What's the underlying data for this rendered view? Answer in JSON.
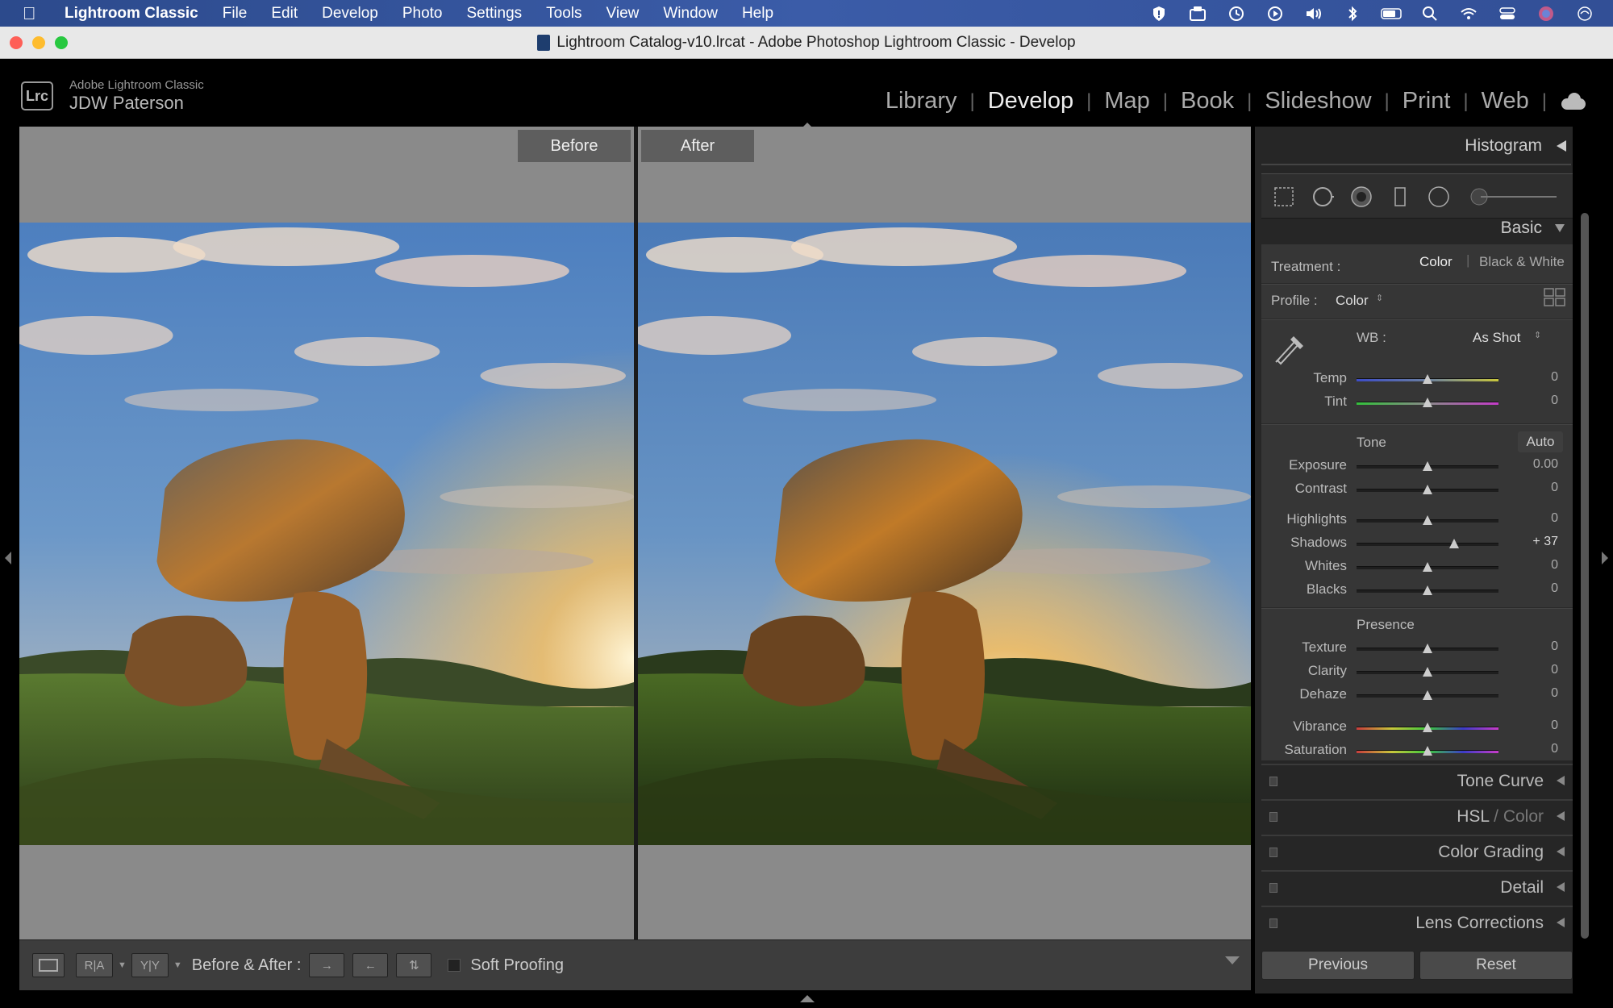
{
  "menubar": {
    "app_name": "Lightroom Classic",
    "items": [
      "File",
      "Edit",
      "Develop",
      "Photo",
      "Settings",
      "Tools",
      "View",
      "Window",
      "Help"
    ],
    "status_icons": [
      "shield-icon",
      "archive-icon",
      "time-machine-icon",
      "play-icon",
      "volume-icon",
      "bluetooth-icon",
      "battery-icon",
      "search-icon",
      "wifi-icon",
      "control-center-icon",
      "avatar-icon",
      "siri-icon"
    ]
  },
  "window": {
    "title": "Lightroom Catalog-v10.lrcat - Adobe Photoshop Lightroom Classic - Develop"
  },
  "identity": {
    "logo": "Lrc",
    "product": "Adobe Lightroom Classic",
    "name": "JDW Paterson"
  },
  "modules": {
    "items": [
      "Library",
      "Develop",
      "Map",
      "Book",
      "Slideshow",
      "Print",
      "Web"
    ],
    "active": "Develop",
    "separator": "|"
  },
  "view": {
    "before_label": "Before",
    "after_label": "After"
  },
  "toolbar": {
    "loupe_label": "",
    "ra_label": "R|A",
    "yy_label": "Y|Y",
    "before_after_label": "Before & After :",
    "copy_before_to_after": "→",
    "copy_after_to_before": "←",
    "swap": "⇅",
    "soft_proofing_label": "Soft Proofing",
    "soft_proofing_checked": false
  },
  "panel": {
    "histogram_label": "Histogram",
    "basic_label": "Basic",
    "treatment_label": "Treatment :",
    "treatment_color": "Color",
    "treatment_bw": "Black & White",
    "profile_label": "Profile :",
    "profile_value": "Color",
    "wb_label": "WB :",
    "wb_value": "As Shot",
    "tone_label": "Tone",
    "auto_label": "Auto",
    "presence_label": "Presence",
    "sliders": {
      "temp": {
        "label": "Temp",
        "value": "0",
        "pos": 0.5
      },
      "tint": {
        "label": "Tint",
        "value": "0",
        "pos": 0.5
      },
      "exposure": {
        "label": "Exposure",
        "value": "0.00",
        "pos": 0.5
      },
      "contrast": {
        "label": "Contrast",
        "value": "0",
        "pos": 0.5
      },
      "highlights": {
        "label": "Highlights",
        "value": "0",
        "pos": 0.5
      },
      "shadows": {
        "label": "Shadows",
        "value": "+ 37",
        "pos": 0.685
      },
      "whites": {
        "label": "Whites",
        "value": "0",
        "pos": 0.5
      },
      "blacks": {
        "label": "Blacks",
        "value": "0",
        "pos": 0.5
      },
      "texture": {
        "label": "Texture",
        "value": "0",
        "pos": 0.5
      },
      "clarity": {
        "label": "Clarity",
        "value": "0",
        "pos": 0.5
      },
      "dehaze": {
        "label": "Dehaze",
        "value": "0",
        "pos": 0.5
      },
      "vibrance": {
        "label": "Vibrance",
        "value": "0",
        "pos": 0.5
      },
      "saturation": {
        "label": "Saturation",
        "value": "0",
        "pos": 0.5
      }
    },
    "tone_curve_label": "Tone Curve",
    "hsl_label": "HSL",
    "hsl_sep": " / ",
    "color_label": "Color",
    "color_grading_label": "Color Grading",
    "detail_label": "Detail",
    "lens_corrections_label": "Lens Corrections",
    "previous_label": "Previous",
    "reset_label": "Reset"
  }
}
